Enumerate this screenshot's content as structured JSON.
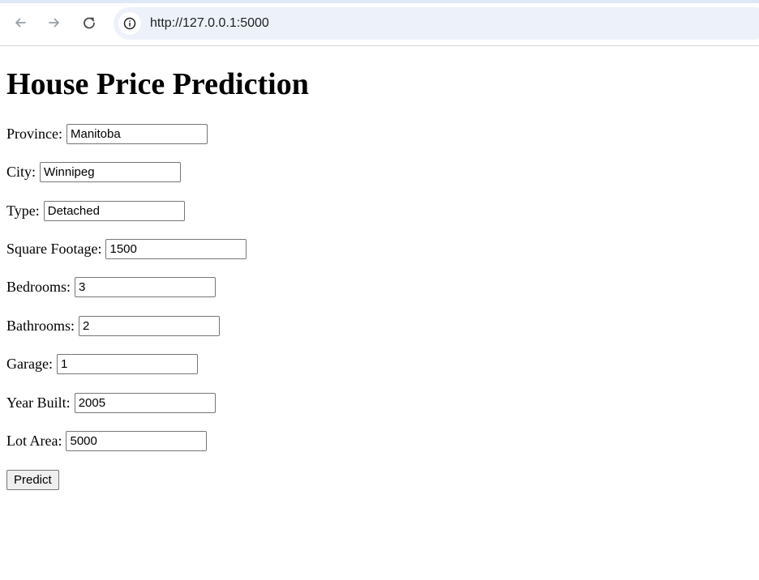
{
  "browser": {
    "url": "http://127.0.0.1:5000"
  },
  "page": {
    "title": "House Price Prediction",
    "fields": [
      {
        "label": "Province:",
        "value": "Manitoba"
      },
      {
        "label": "City:",
        "value": "Winnipeg"
      },
      {
        "label": "Type:",
        "value": "Detached"
      },
      {
        "label": "Square Footage:",
        "value": "1500"
      },
      {
        "label": "Bedrooms:",
        "value": "3"
      },
      {
        "label": "Bathrooms:",
        "value": "2"
      },
      {
        "label": "Garage:",
        "value": "1"
      },
      {
        "label": "Year Built:",
        "value": "2005"
      },
      {
        "label": "Lot Area:",
        "value": "5000"
      }
    ],
    "predict_label": "Predict"
  },
  "icons": {
    "back": "back-arrow-icon",
    "forward": "forward-arrow-icon",
    "reload": "reload-icon",
    "site_info": "info-icon"
  }
}
